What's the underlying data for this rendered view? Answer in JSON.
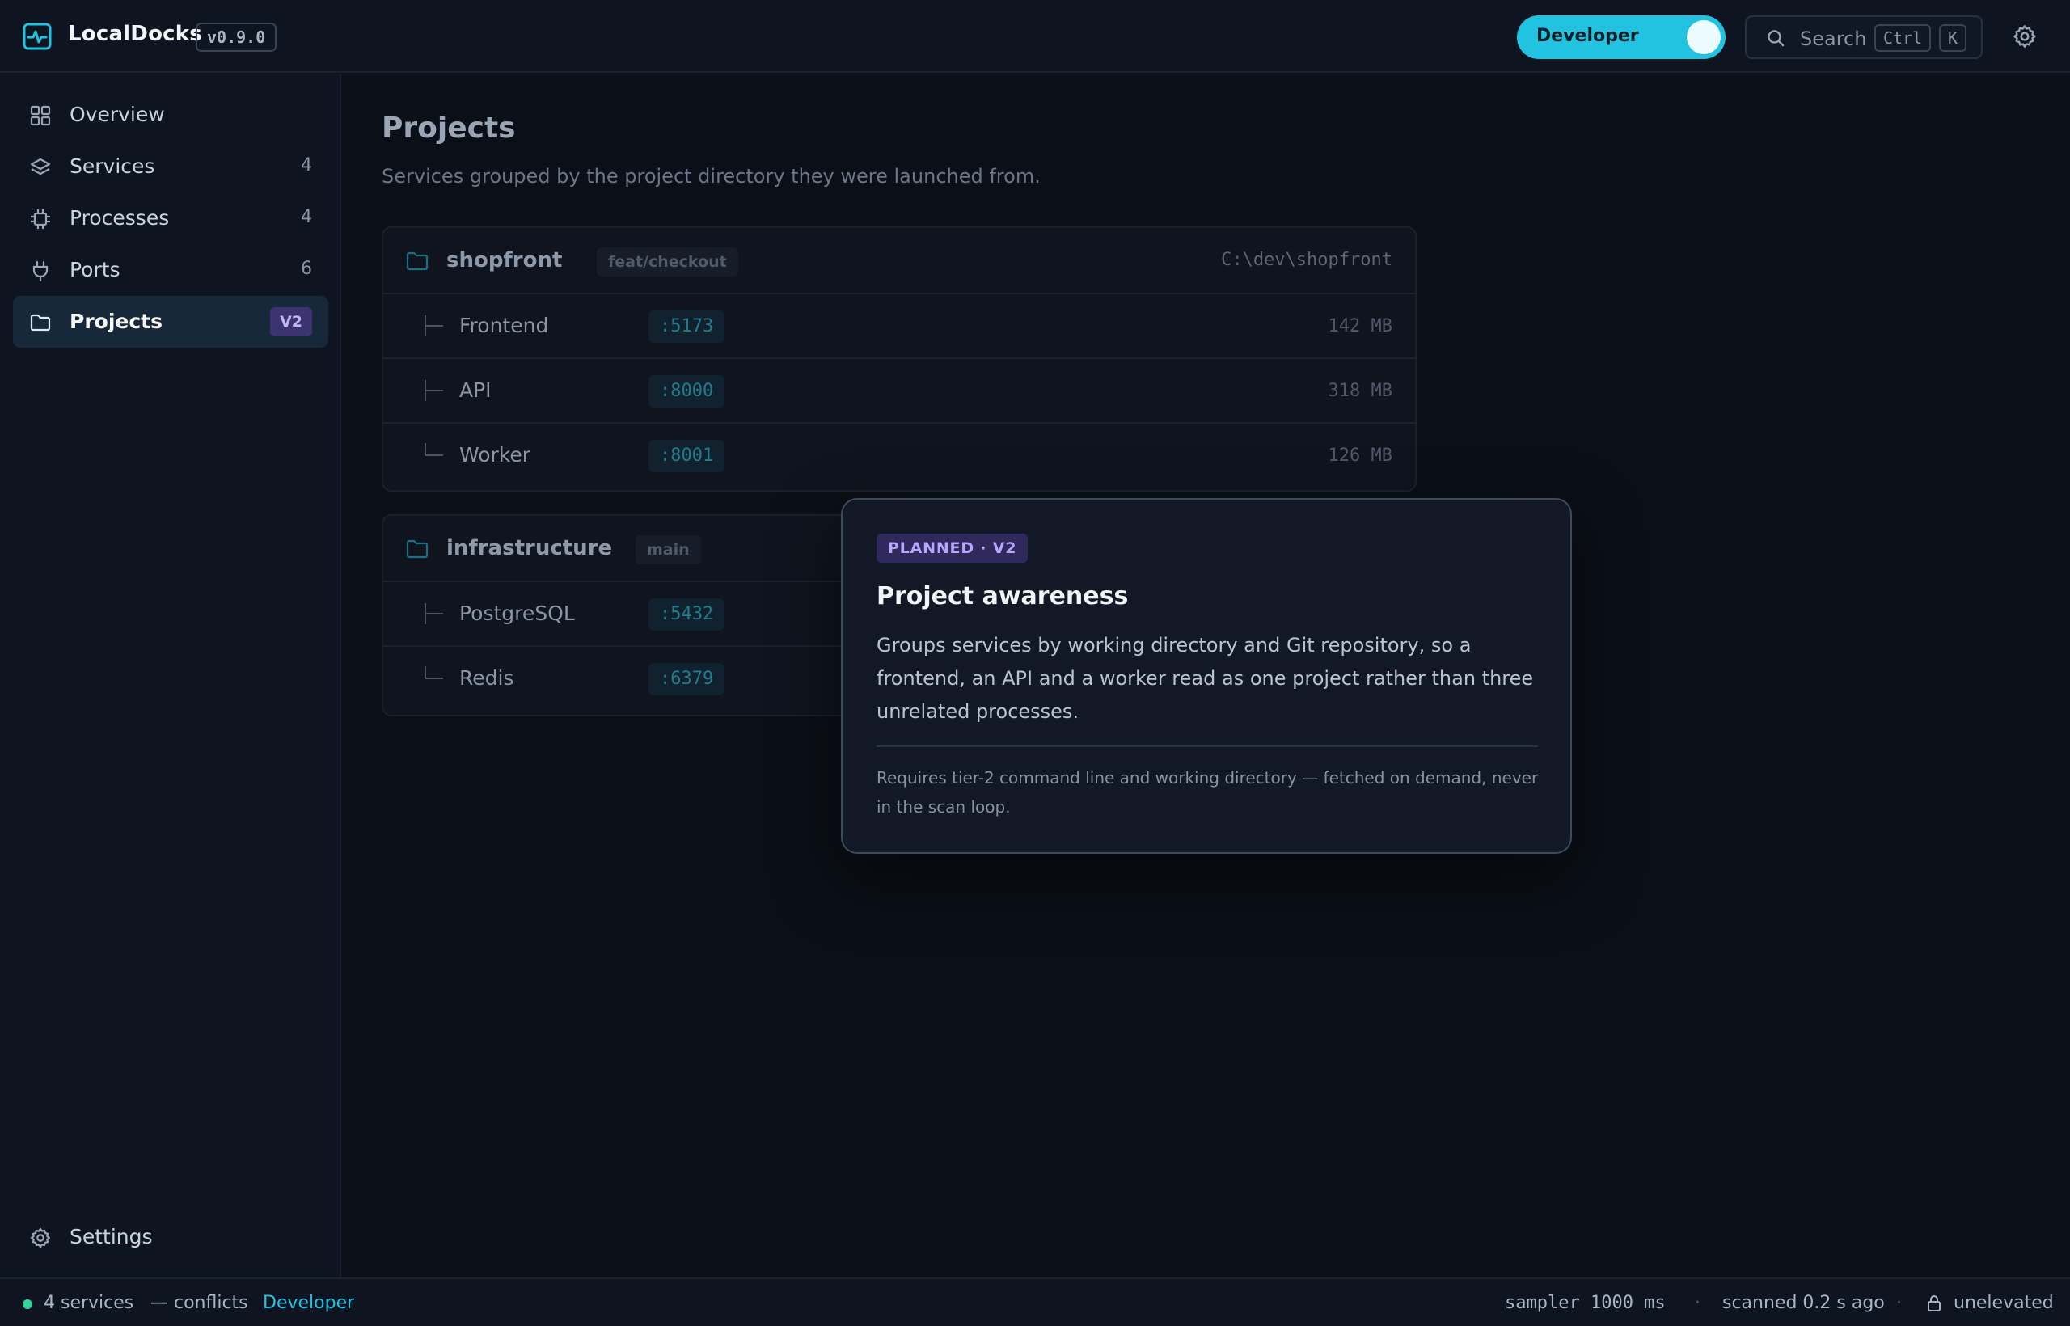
{
  "app": {
    "name": "LocalDocks",
    "version": "v0.9.0",
    "mode_toggle_label": "Developer",
    "accent_color": "#22c3e0"
  },
  "search": {
    "label": "Search",
    "shortcut_keys": [
      "Ctrl",
      "K"
    ]
  },
  "sidebar": {
    "items": [
      {
        "label": "Overview",
        "icon": "grid-icon",
        "count": ""
      },
      {
        "label": "Services",
        "icon": "layers-icon",
        "count": "4"
      },
      {
        "label": "Processes",
        "icon": "cpu-icon",
        "count": "4"
      },
      {
        "label": "Ports",
        "icon": "plug-icon",
        "count": "6"
      },
      {
        "label": "Projects",
        "icon": "folder-icon",
        "badge": "V2",
        "active": true
      }
    ],
    "settings_label": "Settings"
  },
  "page": {
    "title": "Projects",
    "subtitle": "Services grouped by the project directory they were launched from."
  },
  "projects": [
    {
      "name": "shopfront",
      "branch": "feat/checkout",
      "path": "C:\\dev\\shopfront",
      "services": [
        {
          "name": "Frontend",
          "port": ":5173",
          "memory": "142 MB"
        },
        {
          "name": "API",
          "port": ":8000",
          "memory": "318 MB"
        },
        {
          "name": "Worker",
          "port": ":8001",
          "memory": "126 MB"
        }
      ]
    },
    {
      "name": "infrastructure",
      "branch": "main",
      "services": [
        {
          "name": "PostgreSQL",
          "port": ":5432"
        },
        {
          "name": "Redis",
          "port": ":6379"
        }
      ]
    }
  ],
  "popover": {
    "pill": "PLANNED · V2",
    "title": "Project awareness",
    "body": "Groups services by working directory and Git repository, so a frontend, an API and a worker read as one project rather than three unrelated processes.",
    "footnote": "Requires tier-2 command line and working directory — fetched on demand, never in the scan loop."
  },
  "statusbar": {
    "services": "4 services",
    "conflicts": "— conflicts",
    "mode": "Developer",
    "sampler": "sampler 1000 ms",
    "separator": "·",
    "scanned": "scanned 0.2 s ago",
    "elevation": "unelevated",
    "status_color": "#34d399"
  }
}
